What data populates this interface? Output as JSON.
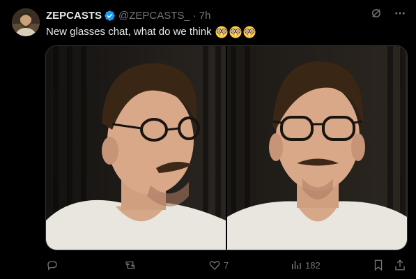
{
  "tweet": {
    "display_name": "ZEPCASTS",
    "handle": "@ZEPCASTS_",
    "separator": "·",
    "time": "7h",
    "text": "New glasses chat, what do we think",
    "emoji": [
      "nerd-face-icon",
      "nerd-face-icon",
      "nerd-face-icon"
    ]
  },
  "media": {
    "photos": [
      {
        "subject": "man-glasses-side-profile"
      },
      {
        "subject": "man-glasses-front-facing"
      }
    ]
  },
  "actions": {
    "reply_count": "",
    "retweet_count": "",
    "like_count": "7",
    "view_count": "182"
  },
  "icons": {
    "verified": "verified-badge-icon",
    "grok": "grok-icon",
    "more": "more-icon",
    "reply": "reply-icon",
    "retweet": "retweet-icon",
    "like": "heart-icon",
    "views": "views-icon",
    "bookmark": "bookmark-icon",
    "share": "share-icon"
  },
  "colors": {
    "verified": "#1d9bf0",
    "muted": "#71767b",
    "text": "#e7e9ea",
    "background": "#000000"
  }
}
